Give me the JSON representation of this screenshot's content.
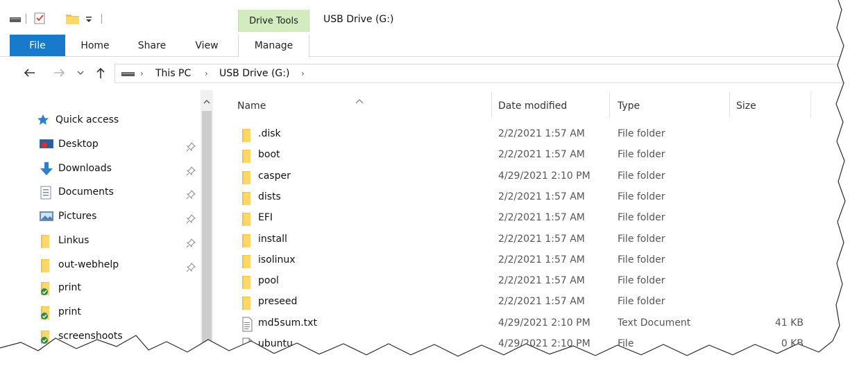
{
  "window_title": "USB Drive (G:)",
  "ribbon": {
    "context_group": "Drive Tools",
    "tabs": [
      {
        "id": "file",
        "label": "File"
      },
      {
        "id": "home",
        "label": "Home"
      },
      {
        "id": "share",
        "label": "Share"
      },
      {
        "id": "view",
        "label": "View"
      },
      {
        "id": "manage",
        "label": "Manage"
      }
    ]
  },
  "quick_access_toolbar": {
    "icons": [
      "drive-icon",
      "properties-check-icon",
      "new-folder-icon",
      "customize-toolbar-icon"
    ]
  },
  "address": {
    "crumbs": [
      "This PC",
      "USB Drive (G:)"
    ],
    "nav_icons": [
      "back-arrow-icon",
      "forward-arrow-icon",
      "recent-dropdown-icon",
      "up-arrow-icon"
    ]
  },
  "sidebar": {
    "items": [
      {
        "label": "Quick access",
        "icon": "star-icon",
        "pinned": false
      },
      {
        "label": "Desktop",
        "icon": "desktop-icon",
        "pinned": true
      },
      {
        "label": "Downloads",
        "icon": "download-arrow-icon",
        "pinned": true
      },
      {
        "label": "Documents",
        "icon": "documents-icon",
        "pinned": true
      },
      {
        "label": "Pictures",
        "icon": "pictures-icon",
        "pinned": true
      },
      {
        "label": "Linkus",
        "icon": "folder-icon",
        "pinned": true
      },
      {
        "label": "out-webhelp",
        "icon": "folder-icon",
        "pinned": true
      },
      {
        "label": "print",
        "icon": "synced-folder-icon",
        "pinned": false
      },
      {
        "label": "print",
        "icon": "synced-folder-icon",
        "pinned": false
      },
      {
        "label": "screenshoots",
        "icon": "synced-folder-icon",
        "pinned": false
      }
    ]
  },
  "list": {
    "columns": [
      {
        "id": "name",
        "label": "Name"
      },
      {
        "id": "date",
        "label": "Date modified"
      },
      {
        "id": "type",
        "label": "Type"
      },
      {
        "id": "size",
        "label": "Size"
      }
    ],
    "sorted_by": "name",
    "rows": [
      {
        "name": ".disk",
        "date": "2/2/2021 1:57 AM",
        "type": "File folder",
        "size": "",
        "icon": "folder-icon"
      },
      {
        "name": "boot",
        "date": "2/2/2021 1:57 AM",
        "type": "File folder",
        "size": "",
        "icon": "folder-icon"
      },
      {
        "name": "casper",
        "date": "4/29/2021 2:10 PM",
        "type": "File folder",
        "size": "",
        "icon": "folder-icon"
      },
      {
        "name": "dists",
        "date": "2/2/2021 1:57 AM",
        "type": "File folder",
        "size": "",
        "icon": "folder-icon"
      },
      {
        "name": "EFI",
        "date": "2/2/2021 1:57 AM",
        "type": "File folder",
        "size": "",
        "icon": "folder-icon"
      },
      {
        "name": "install",
        "date": "2/2/2021 1:57 AM",
        "type": "File folder",
        "size": "",
        "icon": "folder-icon"
      },
      {
        "name": "isolinux",
        "date": "2/2/2021 1:57 AM",
        "type": "File folder",
        "size": "",
        "icon": "folder-icon"
      },
      {
        "name": "pool",
        "date": "2/2/2021 1:57 AM",
        "type": "File folder",
        "size": "",
        "icon": "folder-icon"
      },
      {
        "name": "preseed",
        "date": "2/2/2021 1:57 AM",
        "type": "File folder",
        "size": "",
        "icon": "folder-icon"
      },
      {
        "name": "md5sum.txt",
        "date": "4/29/2021 2:10 PM",
        "type": "Text Document",
        "size": "41 KB",
        "icon": "text-file-icon"
      },
      {
        "name": "ubuntu",
        "date": "4/29/2021 2:10 PM",
        "type": "File",
        "size": "0 KB",
        "icon": "blank-file-icon"
      }
    ]
  },
  "colors": {
    "file_tab": "#1979ca",
    "drive_tools": "#d3ecbf",
    "folder": "#f6c244",
    "accent": "#1979ca"
  }
}
